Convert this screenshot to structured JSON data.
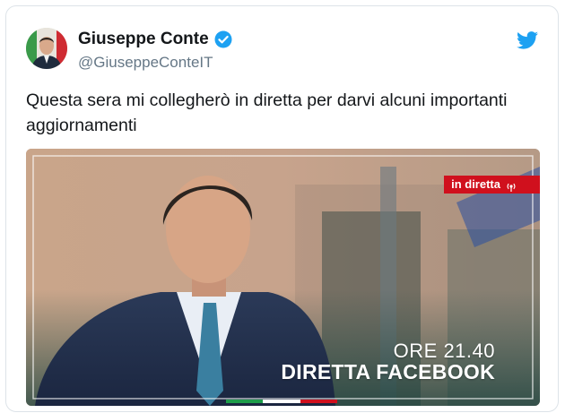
{
  "tweet": {
    "author_name": "Giuseppe Conte",
    "handle": "@GiuseppeConteIT",
    "verified": true,
    "text": "Questa sera mi collegherò in diretta per darvi alcuni importanti aggiornamenti",
    "icons": {
      "avatar": "user-avatar",
      "verified": "verified-badge-icon",
      "platform": "twitter-bird-icon"
    }
  },
  "media": {
    "badge_label": "in diretta",
    "badge_icon": "live-broadcast-icon",
    "time_text": "ORE 21.40",
    "headline": "DIRETTA FACEBOOK",
    "flag_colors": [
      "#1e9c4a",
      "#ffffff",
      "#d0101d"
    ]
  },
  "colors": {
    "twitter_blue": "#1da1f2",
    "live_red": "#d0101d",
    "text_primary": "#14171a",
    "text_secondary": "#657786"
  }
}
